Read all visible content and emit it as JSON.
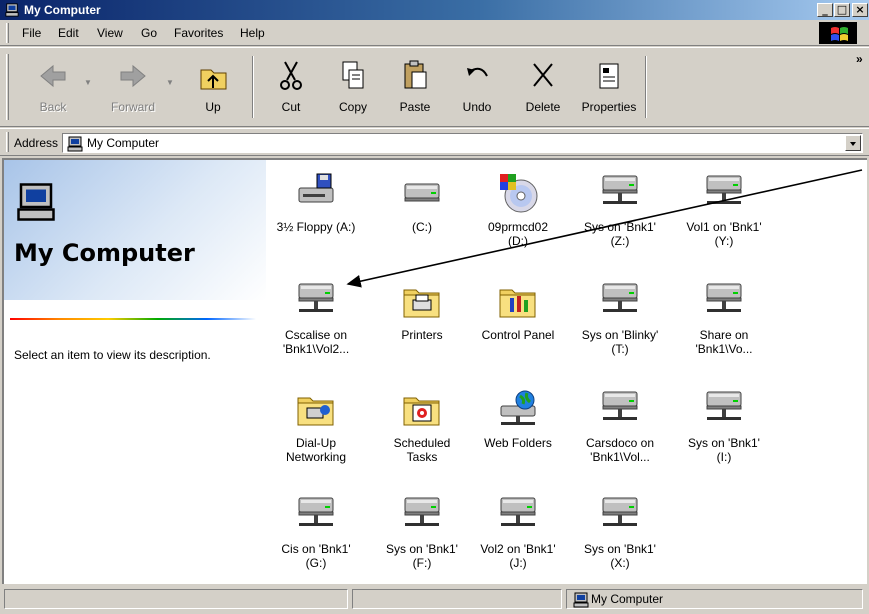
{
  "window": {
    "title": "My Computer",
    "minimize": "_",
    "maximize": "□",
    "close": "×"
  },
  "menu": [
    "File",
    "Edit",
    "View",
    "Go",
    "Favorites",
    "Help"
  ],
  "toolbar": {
    "back": "Back",
    "forward": "Forward",
    "up": "Up",
    "cut": "Cut",
    "copy": "Copy",
    "paste": "Paste",
    "undo": "Undo",
    "delete": "Delete",
    "properties": "Properties",
    "overflow": "»"
  },
  "address": {
    "label": "Address",
    "value": "My Computer"
  },
  "panel": {
    "title": "My Computer",
    "description": "Select an item to view its description."
  },
  "items": [
    {
      "label": "3½ Floppy (A:)",
      "icon": "floppy-drive-icon"
    },
    {
      "label": "(C:)",
      "icon": "hard-drive-icon"
    },
    {
      "label": "09prmcd02\n(D:)",
      "icon": "cd-drive-icon"
    },
    {
      "label": "Sys on 'Bnk1'\n(Z:)",
      "icon": "network-drive-icon"
    },
    {
      "label": "Vol1 on 'Bnk1'\n(Y:)",
      "icon": "network-drive-icon"
    },
    {
      "label": "Cscalise on\n'Bnk1\\Vol2...",
      "icon": "network-drive-icon"
    },
    {
      "label": "Printers",
      "icon": "printers-folder-icon"
    },
    {
      "label": "Control Panel",
      "icon": "control-panel-icon"
    },
    {
      "label": "Sys on 'Blinky'\n(T:)",
      "icon": "network-drive-icon"
    },
    {
      "label": "Share on\n'Bnk1\\Vo...",
      "icon": "network-drive-icon"
    },
    {
      "label": "Dial-Up\nNetworking",
      "icon": "dial-up-networking-icon"
    },
    {
      "label": "Scheduled\nTasks",
      "icon": "scheduled-tasks-icon"
    },
    {
      "label": "Web Folders",
      "icon": "web-folders-icon"
    },
    {
      "label": "Carsdoco on\n'Bnk1\\Vol...",
      "icon": "network-drive-icon"
    },
    {
      "label": "Sys on 'Bnk1'\n(I:)",
      "icon": "network-drive-icon"
    },
    {
      "label": "Cis on 'Bnk1'\n(G:)",
      "icon": "network-drive-icon"
    },
    {
      "label": "Sys on 'Bnk1'\n(F:)",
      "icon": "network-drive-icon"
    },
    {
      "label": "Vol2 on 'Bnk1'\n(J:)",
      "icon": "network-drive-icon"
    },
    {
      "label": "Sys on 'Bnk1'\n(X:)",
      "icon": "network-drive-icon"
    }
  ],
  "status": {
    "location": "My Computer"
  }
}
